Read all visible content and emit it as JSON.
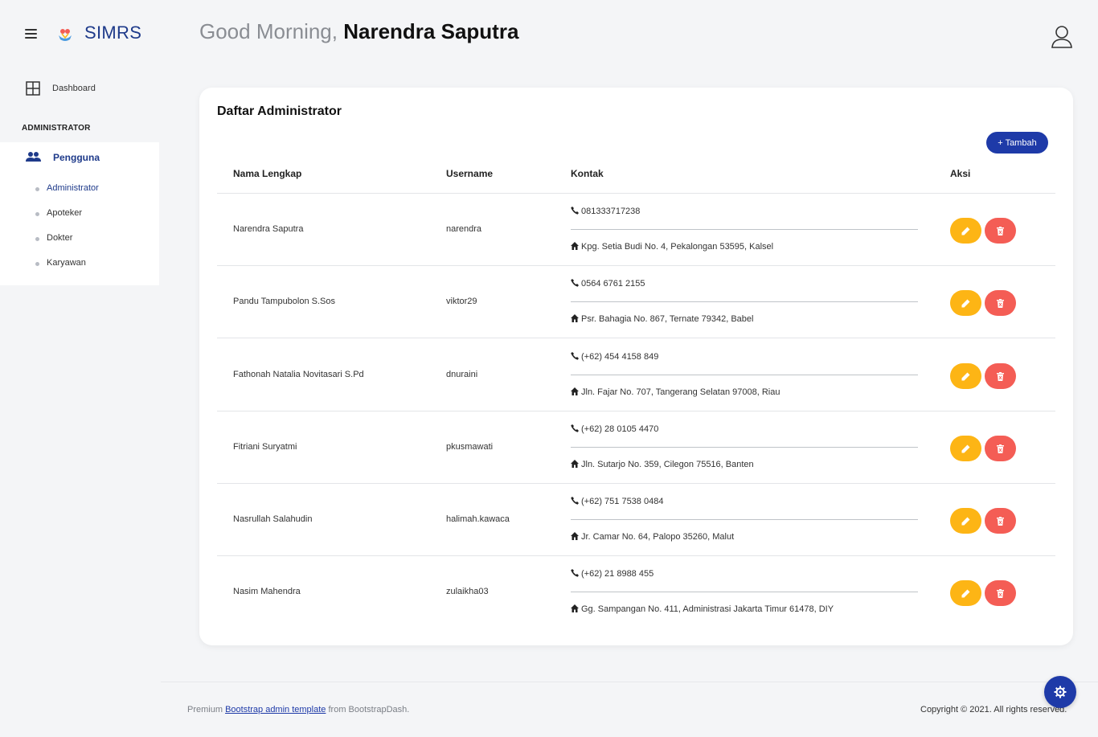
{
  "header": {
    "brand": "SIMRS",
    "greeting": "Good Morning,",
    "user_name": "Narendra Saputra"
  },
  "sidebar": {
    "dashboard_label": "Dashboard",
    "section_label": "ADMINISTRATOR",
    "group_label": "Pengguna",
    "sub_items": [
      {
        "label": "Administrator",
        "active": true
      },
      {
        "label": "Apoteker",
        "active": false
      },
      {
        "label": "Dokter",
        "active": false
      },
      {
        "label": "Karyawan",
        "active": false
      }
    ]
  },
  "main": {
    "card_title": "Daftar Administrator",
    "add_button": "+ Tambah",
    "columns": [
      "Nama Lengkap",
      "Username",
      "Kontak",
      "Aksi"
    ],
    "rows": [
      {
        "name": "Narendra Saputra",
        "username": "narendra",
        "phone": "081333717238",
        "address": "Kpg. Setia Budi No. 4, Pekalongan 53595, Kalsel"
      },
      {
        "name": "Pandu Tampubolon S.Sos",
        "username": "viktor29",
        "phone": "0564 6761 2155",
        "address": "Psr. Bahagia No. 867, Ternate 79342, Babel"
      },
      {
        "name": "Fathonah Natalia Novitasari S.Pd",
        "username": "dnuraini",
        "phone": "(+62) 454 4158 849",
        "address": "Jln. Fajar No. 707, Tangerang Selatan 97008, Riau"
      },
      {
        "name": "Fitriani Suryatmi",
        "username": "pkusmawati",
        "phone": "(+62) 28 0105 4470",
        "address": "Jln. Sutarjo No. 359, Cilegon 75516, Banten"
      },
      {
        "name": "Nasrullah Salahudin",
        "username": "halimah.kawaca",
        "phone": "(+62) 751 7538 0484",
        "address": "Jr. Camar No. 64, Palopo 35260, Malut"
      },
      {
        "name": "Nasim Mahendra",
        "username": "zulaikha03",
        "phone": "(+62) 21 8988 455",
        "address": "Gg. Sampangan No. 411, Administrasi Jakarta Timur 61478, DIY"
      }
    ]
  },
  "footer": {
    "left_prefix": "Premium ",
    "left_link": "Bootstrap admin template",
    "left_suffix": " from BootstrapDash.",
    "right": "Copyright © 2021. All rights reserved."
  },
  "colors": {
    "brand": "#1e3a8a",
    "primary_button": "#1e3aa8",
    "edit_button": "#fdb515",
    "delete_button": "#f45d55"
  }
}
